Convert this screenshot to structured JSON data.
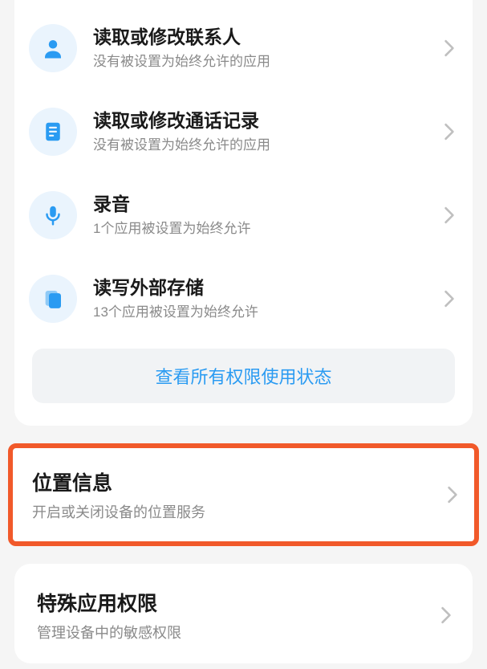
{
  "permissions": {
    "items": [
      {
        "title": "读取或修改联系人",
        "subtitle": "没有被设置为始终允许的应用"
      },
      {
        "title": "读取或修改通话记录",
        "subtitle": "没有被设置为始终允许的应用"
      },
      {
        "title": "录音",
        "subtitle": "1个应用被设置为始终允许"
      },
      {
        "title": "读写外部存储",
        "subtitle": "13个应用被设置为始终允许"
      }
    ],
    "view_all_label": "查看所有权限使用状态"
  },
  "location": {
    "title": "位置信息",
    "subtitle": "开启或关闭设备的位置服务"
  },
  "special": {
    "title": "特殊应用权限",
    "subtitle": "管理设备中的敏感权限"
  }
}
